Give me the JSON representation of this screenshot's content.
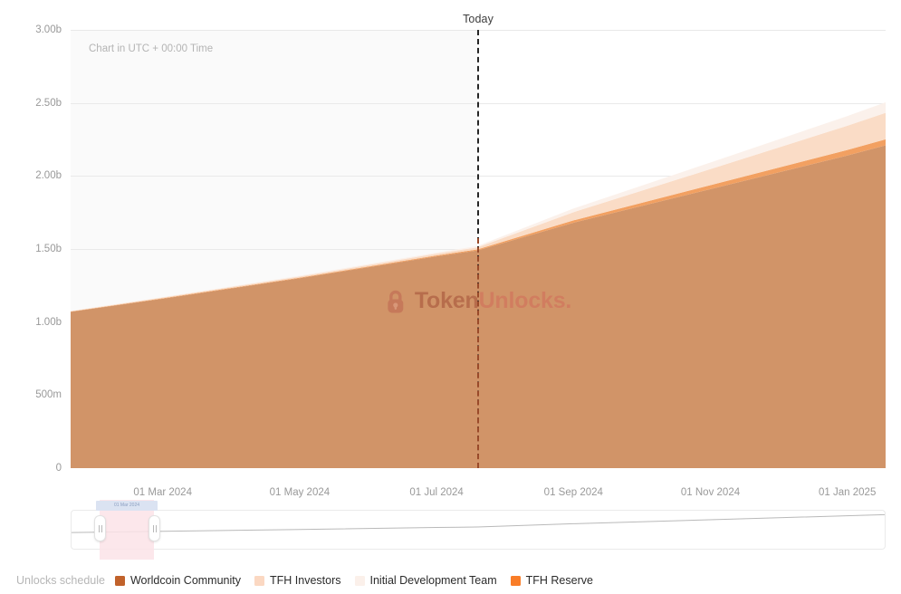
{
  "header": {
    "today_marker_label": "Today"
  },
  "annotations": {
    "utc_note": "Chart in UTC + 00:00 Time",
    "watermark_first": "Token",
    "watermark_second": "Unlocks.",
    "watermark_icon": "lock-icon"
  },
  "navigator": {
    "tooltip_label": "01 Mar 2024",
    "left_handle": "navigator-left-handle",
    "right_handle": "navigator-right-handle"
  },
  "legend": {
    "title": "Unlocks schedule",
    "items": [
      {
        "label": "Worldcoin Community",
        "color": "#c1622b"
      },
      {
        "label": "TFH Investors",
        "color": "#fbd8c2"
      },
      {
        "label": "Initial Development Team",
        "color": "#fbf0ea"
      },
      {
        "label": "TFH Reserve",
        "color": "#f97d28"
      }
    ]
  },
  "chart_data": {
    "type": "area",
    "title": "",
    "subtitle": "Chart in UTC + 00:00 Time",
    "xlabel": "",
    "ylabel": "",
    "stacked": true,
    "grid": true,
    "legend_position": "bottom",
    "ylim": [
      0,
      3000000000
    ],
    "ytick_labels": [
      "3.00b",
      "2.50b",
      "2.00b",
      "1.50b",
      "1.00b",
      "500m",
      "0"
    ],
    "ytick_values": [
      3000000000,
      2500000000,
      2000000000,
      1500000000,
      1000000000,
      500000000,
      0
    ],
    "xtick_labels": [
      "01 Mar 2024",
      "01 May 2024",
      "01 Jul 2024",
      "01 Sep 2024",
      "01 Nov 2024",
      "01 Jan 2025"
    ],
    "xtick_positions": [
      0.113,
      0.281,
      0.449,
      0.617,
      0.785,
      0.953
    ],
    "xlim": [
      "01 Feb 2024",
      "01 Feb 2025"
    ],
    "today_marker_x": 0.499,
    "x": [
      0.0,
      0.113,
      0.281,
      0.449,
      0.499,
      0.617,
      0.785,
      0.953,
      1.0
    ],
    "series": [
      {
        "name": "Worldcoin Community",
        "color": "#d19468",
        "values": [
          1070000000,
          1160000000,
          1300000000,
          1450000000,
          1490000000,
          1680000000,
          1910000000,
          2140000000,
          2210000000
        ]
      },
      {
        "name": "TFH Reserve",
        "color": "#f2a061",
        "values": [
          2000000,
          3000000,
          4000000,
          6000000,
          7000000,
          16000000,
          27000000,
          38000000,
          41000000
        ]
      },
      {
        "name": "TFH Investors",
        "color": "#fadcc6",
        "values": [
          3000000,
          5000000,
          8000000,
          12000000,
          14000000,
          56000000,
          110000000,
          166000000,
          181000000
        ]
      },
      {
        "name": "Initial Development Team",
        "color": "#fbf1eb",
        "values": [
          2000000,
          3000000,
          5000000,
          8000000,
          9000000,
          25000000,
          45000000,
          66000000,
          72000000
        ]
      }
    ],
    "total_values": [
      1077000000,
      1171000000,
      1317000000,
      1476000000,
      1520000000,
      1777000000,
      2092000000,
      2410000000,
      2504000000
    ]
  }
}
